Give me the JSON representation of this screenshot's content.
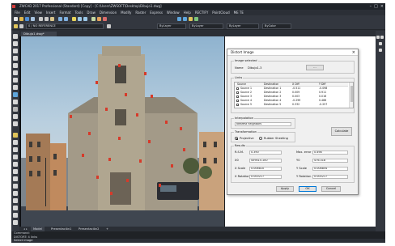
{
  "window": {
    "title": "ZWCAD 2017 Professional (Standard) [Copy] - [C:\\Users\\ZWSOFT\\Desktop\\Dibujo1.dwg]"
  },
  "menu": [
    "File",
    "Edit",
    "View",
    "Insert",
    "Format",
    "Tools",
    "Draw",
    "Dimension",
    "Modify",
    "Raster",
    "Express",
    "Window",
    "Help",
    "RECTIFY",
    "PointCloud",
    "ME TE"
  ],
  "toolbar": {
    "layer_combo": "0 / NO REFERENCE",
    "color_combo": "ByLayer",
    "linetype_combo": "ByLayer",
    "lineweight_combo": "ByLayer",
    "plot_combo": "ByColor"
  },
  "document_tab": "Dibujo1.dwg*",
  "dialog": {
    "title": "Distort Image",
    "image_group": "Image selected",
    "name_label": "Name",
    "name_value": "Dibujo1-3",
    "image_button": "...",
    "links_group": "Links",
    "columns": [
      "Source",
      "Destination",
      "X Diff",
      "Y Diff"
    ],
    "links": [
      {
        "source": "Source 1",
        "dest": "Destination 1",
        "xdiff": "-0.511",
        "ydiff": "-0.098"
      },
      {
        "source": "Source 2",
        "dest": "Destination 2",
        "xdiff": "0.009",
        "ydiff": "0.911"
      },
      {
        "source": "Source 3",
        "dest": "Destination 3",
        "xdiff": "0.003",
        "ydiff": "0.016"
      },
      {
        "source": "Source 4",
        "dest": "Destination 4",
        "xdiff": "-0.299",
        "ydiff": "0.486"
      },
      {
        "source": "Source 5",
        "dest": "Destination 5",
        "xdiff": "0.332",
        "ydiff": "-0.257"
      }
    ],
    "interpolation_group": "Interpolation",
    "interpolation_value": "Nearest neighbors",
    "transformation_group": "Transformation",
    "projective_label": "Projective",
    "rubber_sheeting_label": "Rubber Sheeting",
    "calculate_button": "Calculate",
    "results_group": "Results",
    "results": {
      "rms_label": "R.S.M.",
      "rms_value": "0.390",
      "maxerr_label": "Max. error",
      "maxerr_value": "0.498",
      "xo_label": "X0",
      "xo_value": "459415.100",
      "yo_label": "Y0",
      "yo_value": "476.318",
      "xscale_label": "X Scale",
      "xscale_value": "0.006810",
      "yscale_label": "Y Scale",
      "yscale_value": "0.008854",
      "xrot_label": "X Rotation",
      "xrot_value": "0.000217",
      "yrot_label": "Y Rotation",
      "yrot_value": "0.000217"
    },
    "apply_button": "Apply",
    "ok_button": "OK",
    "cancel_button": "Cancel"
  },
  "layout_tabs": [
    "Model",
    "Presentación1",
    "Presentación2",
    "+"
  ],
  "command": {
    "line1": "Command:",
    "line2": "DISTORT: 4 links",
    "prompt": "Select image"
  }
}
